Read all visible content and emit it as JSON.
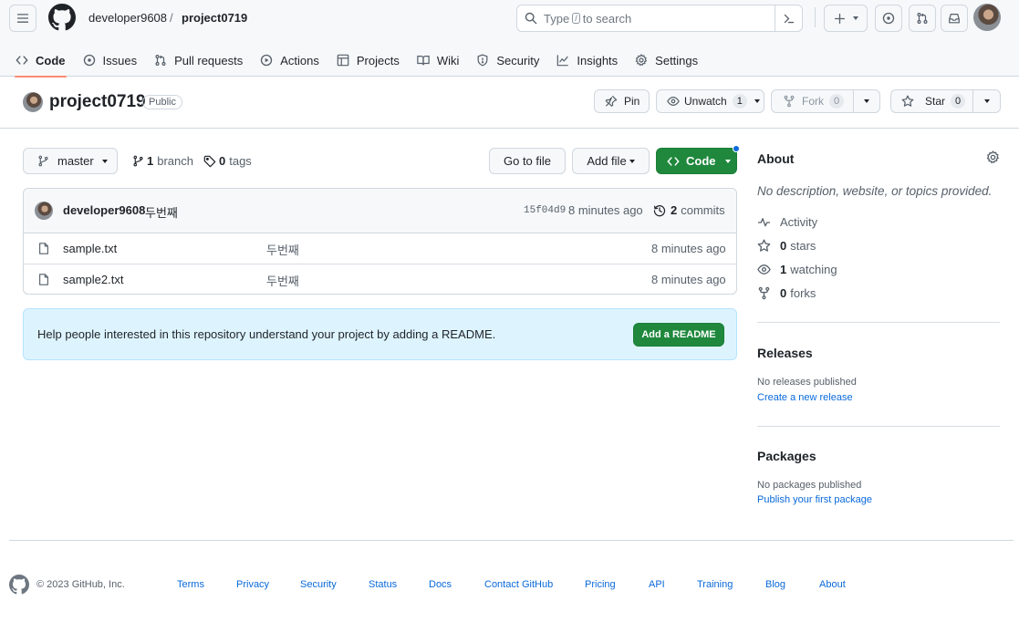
{
  "header": {
    "owner": "developer9608",
    "separator": "/",
    "repo": "project0719",
    "search": {
      "prefix": "Type",
      "key": "/",
      "suffix": "to search"
    }
  },
  "tabs": [
    {
      "label": "Code",
      "icon": "code-icon"
    },
    {
      "label": "Issues",
      "icon": "issue-icon"
    },
    {
      "label": "Pull requests",
      "icon": "pull-request-icon"
    },
    {
      "label": "Actions",
      "icon": "play-icon"
    },
    {
      "label": "Projects",
      "icon": "table-icon"
    },
    {
      "label": "Wiki",
      "icon": "book-icon"
    },
    {
      "label": "Security",
      "icon": "shield-icon"
    },
    {
      "label": "Insights",
      "icon": "graph-icon"
    },
    {
      "label": "Settings",
      "icon": "gear-icon"
    }
  ],
  "repo": {
    "name": "project0719",
    "visibility": "Public",
    "pin_label": "Pin",
    "unwatch_label": "Unwatch",
    "watch_count": "1",
    "fork_label": "Fork",
    "fork_count": "0",
    "star_label": "Star",
    "star_count": "0"
  },
  "branchbar": {
    "branch": "master",
    "branch_count": "1",
    "branch_word": "branch",
    "tag_count": "0",
    "tag_word": "tags",
    "go_to_file": "Go to file",
    "add_file": "Add file",
    "code": "Code"
  },
  "commit": {
    "author": "developer9608",
    "message": "두번째",
    "sha": "15f04d9",
    "time": "8 minutes ago",
    "commit_count": "2",
    "commit_word": "commits"
  },
  "files": [
    {
      "name": "sample.txt",
      "message": "두번째",
      "time": "8 minutes ago"
    },
    {
      "name": "sample2.txt",
      "message": "두번째",
      "time": "8 minutes ago"
    }
  ],
  "readme": {
    "text": "Help people interested in this repository understand your project by adding a README.",
    "button": "Add a README"
  },
  "about": {
    "title": "About",
    "description": "No description, website, or topics provided.",
    "activity": "Activity",
    "stars_count": "0",
    "stars_word": "stars",
    "watching_count": "1",
    "watching_word": "watching",
    "forks_count": "0",
    "forks_word": "forks"
  },
  "releases": {
    "title": "Releases",
    "empty": "No releases published",
    "link": "Create a new release"
  },
  "packages": {
    "title": "Packages",
    "empty": "No packages published",
    "link": "Publish your first package"
  },
  "footer": {
    "copyright": "© 2023 GitHub, Inc.",
    "links": [
      "Terms",
      "Privacy",
      "Security",
      "Status",
      "Docs",
      "Contact GitHub",
      "Pricing",
      "API",
      "Training",
      "Blog",
      "About"
    ]
  },
  "colors": {
    "primary_green": "#1f883d",
    "link_blue": "#0969da",
    "tab_underline": "#fd8c73",
    "readme_bg": "#ddf4ff"
  }
}
